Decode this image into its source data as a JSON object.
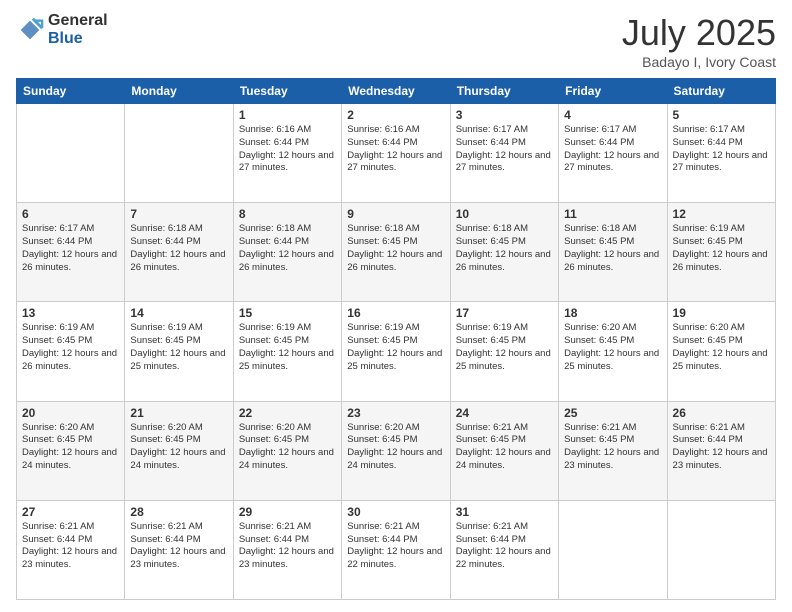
{
  "logo": {
    "general": "General",
    "blue": "Blue"
  },
  "header": {
    "month": "July 2025",
    "location": "Badayo I, Ivory Coast"
  },
  "weekdays": [
    "Sunday",
    "Monday",
    "Tuesday",
    "Wednesday",
    "Thursday",
    "Friday",
    "Saturday"
  ],
  "weeks": [
    [
      {
        "day": "",
        "info": ""
      },
      {
        "day": "",
        "info": ""
      },
      {
        "day": "1",
        "info": "Sunrise: 6:16 AM\nSunset: 6:44 PM\nDaylight: 12 hours and 27 minutes."
      },
      {
        "day": "2",
        "info": "Sunrise: 6:16 AM\nSunset: 6:44 PM\nDaylight: 12 hours and 27 minutes."
      },
      {
        "day": "3",
        "info": "Sunrise: 6:17 AM\nSunset: 6:44 PM\nDaylight: 12 hours and 27 minutes."
      },
      {
        "day": "4",
        "info": "Sunrise: 6:17 AM\nSunset: 6:44 PM\nDaylight: 12 hours and 27 minutes."
      },
      {
        "day": "5",
        "info": "Sunrise: 6:17 AM\nSunset: 6:44 PM\nDaylight: 12 hours and 27 minutes."
      }
    ],
    [
      {
        "day": "6",
        "info": "Sunrise: 6:17 AM\nSunset: 6:44 PM\nDaylight: 12 hours and 26 minutes."
      },
      {
        "day": "7",
        "info": "Sunrise: 6:18 AM\nSunset: 6:44 PM\nDaylight: 12 hours and 26 minutes."
      },
      {
        "day": "8",
        "info": "Sunrise: 6:18 AM\nSunset: 6:44 PM\nDaylight: 12 hours and 26 minutes."
      },
      {
        "day": "9",
        "info": "Sunrise: 6:18 AM\nSunset: 6:45 PM\nDaylight: 12 hours and 26 minutes."
      },
      {
        "day": "10",
        "info": "Sunrise: 6:18 AM\nSunset: 6:45 PM\nDaylight: 12 hours and 26 minutes."
      },
      {
        "day": "11",
        "info": "Sunrise: 6:18 AM\nSunset: 6:45 PM\nDaylight: 12 hours and 26 minutes."
      },
      {
        "day": "12",
        "info": "Sunrise: 6:19 AM\nSunset: 6:45 PM\nDaylight: 12 hours and 26 minutes."
      }
    ],
    [
      {
        "day": "13",
        "info": "Sunrise: 6:19 AM\nSunset: 6:45 PM\nDaylight: 12 hours and 26 minutes."
      },
      {
        "day": "14",
        "info": "Sunrise: 6:19 AM\nSunset: 6:45 PM\nDaylight: 12 hours and 25 minutes."
      },
      {
        "day": "15",
        "info": "Sunrise: 6:19 AM\nSunset: 6:45 PM\nDaylight: 12 hours and 25 minutes."
      },
      {
        "day": "16",
        "info": "Sunrise: 6:19 AM\nSunset: 6:45 PM\nDaylight: 12 hours and 25 minutes."
      },
      {
        "day": "17",
        "info": "Sunrise: 6:19 AM\nSunset: 6:45 PM\nDaylight: 12 hours and 25 minutes."
      },
      {
        "day": "18",
        "info": "Sunrise: 6:20 AM\nSunset: 6:45 PM\nDaylight: 12 hours and 25 minutes."
      },
      {
        "day": "19",
        "info": "Sunrise: 6:20 AM\nSunset: 6:45 PM\nDaylight: 12 hours and 25 minutes."
      }
    ],
    [
      {
        "day": "20",
        "info": "Sunrise: 6:20 AM\nSunset: 6:45 PM\nDaylight: 12 hours and 24 minutes."
      },
      {
        "day": "21",
        "info": "Sunrise: 6:20 AM\nSunset: 6:45 PM\nDaylight: 12 hours and 24 minutes."
      },
      {
        "day": "22",
        "info": "Sunrise: 6:20 AM\nSunset: 6:45 PM\nDaylight: 12 hours and 24 minutes."
      },
      {
        "day": "23",
        "info": "Sunrise: 6:20 AM\nSunset: 6:45 PM\nDaylight: 12 hours and 24 minutes."
      },
      {
        "day": "24",
        "info": "Sunrise: 6:21 AM\nSunset: 6:45 PM\nDaylight: 12 hours and 24 minutes."
      },
      {
        "day": "25",
        "info": "Sunrise: 6:21 AM\nSunset: 6:45 PM\nDaylight: 12 hours and 23 minutes."
      },
      {
        "day": "26",
        "info": "Sunrise: 6:21 AM\nSunset: 6:44 PM\nDaylight: 12 hours and 23 minutes."
      }
    ],
    [
      {
        "day": "27",
        "info": "Sunrise: 6:21 AM\nSunset: 6:44 PM\nDaylight: 12 hours and 23 minutes."
      },
      {
        "day": "28",
        "info": "Sunrise: 6:21 AM\nSunset: 6:44 PM\nDaylight: 12 hours and 23 minutes."
      },
      {
        "day": "29",
        "info": "Sunrise: 6:21 AM\nSunset: 6:44 PM\nDaylight: 12 hours and 23 minutes."
      },
      {
        "day": "30",
        "info": "Sunrise: 6:21 AM\nSunset: 6:44 PM\nDaylight: 12 hours and 22 minutes."
      },
      {
        "day": "31",
        "info": "Sunrise: 6:21 AM\nSunset: 6:44 PM\nDaylight: 12 hours and 22 minutes."
      },
      {
        "day": "",
        "info": ""
      },
      {
        "day": "",
        "info": ""
      }
    ]
  ]
}
